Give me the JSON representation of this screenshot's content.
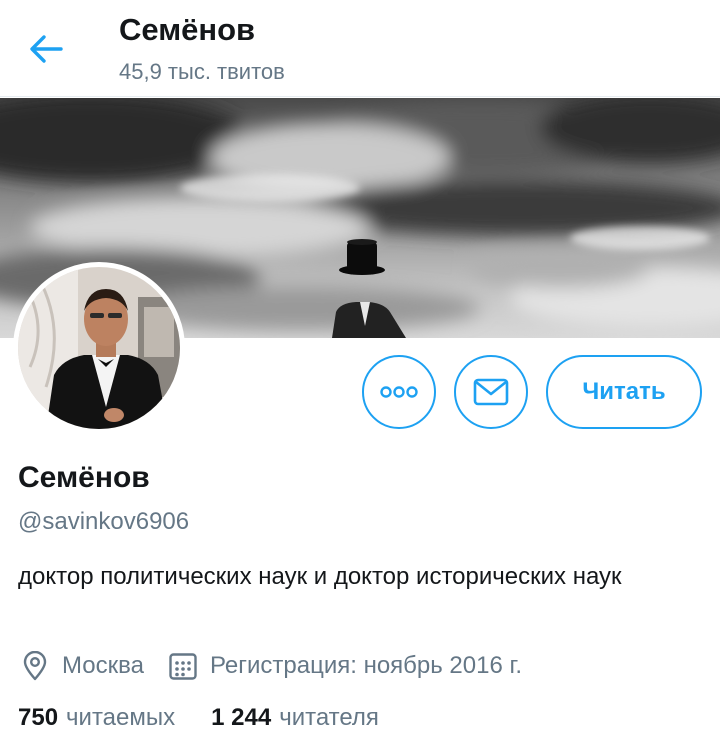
{
  "topbar": {
    "title": "Семёнов",
    "tweet_count": "45,9 тыс. твитов"
  },
  "profile": {
    "name": "Семёнов",
    "handle": "@savinkov6906",
    "bio": "доктор политических наук и доктор исторических наук",
    "location": "Москва",
    "joined": "Регистрация: ноябрь 2016 г."
  },
  "actions": {
    "more_icon": "ellipsis-icon",
    "message_icon": "envelope-icon",
    "follow_label": "Читать"
  },
  "stats": {
    "following_count": "750",
    "following_label": "читаемых",
    "followers_count": "1 244",
    "followers_label": "читателя"
  },
  "colors": {
    "accent": "#1da1f2",
    "text_primary": "#14171a",
    "text_secondary": "#657786"
  }
}
